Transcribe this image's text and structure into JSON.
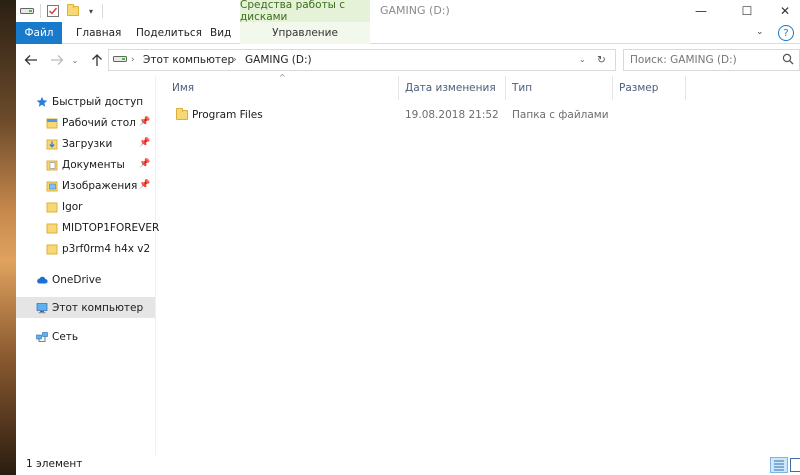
{
  "window": {
    "title": "GAMING (D:)",
    "context_header": "Средства работы с дисками",
    "controls": {
      "minimize": "—",
      "maximize": "☐",
      "close": "✕"
    }
  },
  "ribbon": {
    "tabs": [
      {
        "label": "Файл"
      },
      {
        "label": "Главная"
      },
      {
        "label": "Поделиться"
      },
      {
        "label": "Вид"
      },
      {
        "label": "Управление"
      }
    ],
    "help": "?"
  },
  "navigation": {
    "path": [
      "Этот компьютер",
      "GAMING (D:)"
    ],
    "search_placeholder": "Поиск: GAMING (D:)"
  },
  "sidebar": {
    "items": [
      {
        "label": "Быстрый доступ",
        "icon": "star-icon",
        "pinned": false
      },
      {
        "label": "Рабочий стол",
        "icon": "desktop-folder-icon",
        "pinned": true
      },
      {
        "label": "Загрузки",
        "icon": "downloads-folder-icon",
        "pinned": true
      },
      {
        "label": "Документы",
        "icon": "documents-folder-icon",
        "pinned": true
      },
      {
        "label": "Изображения",
        "icon": "pictures-folder-icon",
        "pinned": true
      },
      {
        "label": "Igor",
        "icon": "folder-icon",
        "pinned": false
      },
      {
        "label": "MIDTOP1FOREVER",
        "icon": "folder-icon",
        "pinned": false
      },
      {
        "label": "p3rf0rm4 h4x v2",
        "icon": "folder-icon",
        "pinned": false
      },
      {
        "label": "OneDrive",
        "icon": "cloud-icon",
        "pinned": false
      },
      {
        "label": "Этот компьютер",
        "icon": "computer-icon",
        "pinned": false,
        "selected": true
      },
      {
        "label": "Сеть",
        "icon": "network-icon",
        "pinned": false
      }
    ]
  },
  "columns": {
    "name": "Имя",
    "date": "Дата изменения",
    "type": "Тип",
    "size": "Размер"
  },
  "files": [
    {
      "name": "Program Files",
      "date": "19.08.2018 21:52",
      "type": "Папка с файлами",
      "size": ""
    }
  ],
  "status": {
    "count_text": "1 элемент"
  },
  "colors": {
    "accent": "#1979ca",
    "context_green": "#e6f2d8",
    "folder": "#f8d775",
    "header_text": "#4c607a"
  }
}
